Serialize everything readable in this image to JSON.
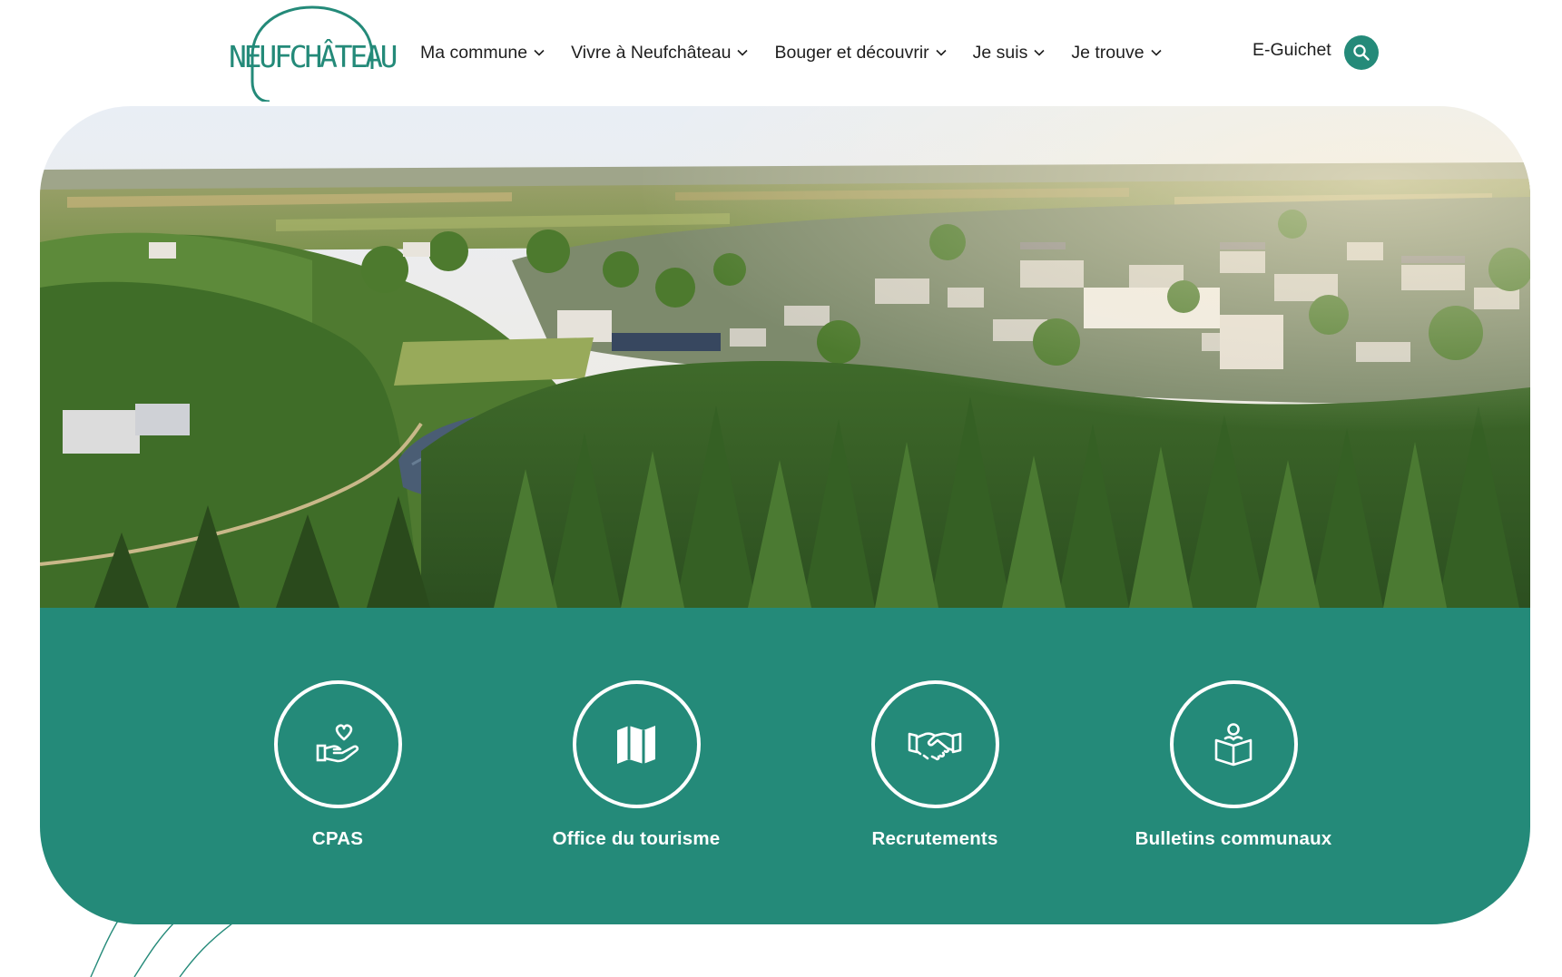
{
  "header": {
    "logo_text": "NEUFCHÂTEAU",
    "nav": [
      {
        "label": "Ma commune"
      },
      {
        "label": "Vivre à Neufchâteau"
      },
      {
        "label": "Bouger et découvrir"
      },
      {
        "label": "Je suis"
      },
      {
        "label": "Je trouve"
      }
    ],
    "eguichet_label": "E-Guichet",
    "search_icon": "search-icon"
  },
  "hero": {
    "image": "aerial-landscape-photo"
  },
  "quick_links": [
    {
      "label": "CPAS",
      "icon": "hand-heart-icon"
    },
    {
      "label": "Office du tourisme",
      "icon": "map-icon"
    },
    {
      "label": "Recrutements",
      "icon": "handshake-icon"
    },
    {
      "label": "Bulletins communaux",
      "icon": "reading-book-icon"
    }
  ],
  "colors": {
    "brand": "#248a79",
    "text": "#1e1e1e",
    "white": "#ffffff"
  }
}
